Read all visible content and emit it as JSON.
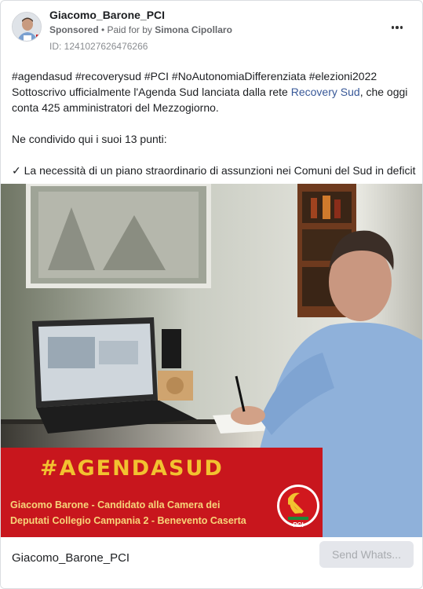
{
  "post": {
    "page_name": "Giacomo_Barone_PCI",
    "sponsored_label": "Sponsored",
    "separator": " • ",
    "paid_for_label": "Paid for by ",
    "payer": "Simona Cipollaro",
    "ad_id": "ID: 1241027626476266",
    "more_icon": "more-horizontal-icon"
  },
  "text": {
    "line1": "#agendasud #recoverysud #PCI #NoAutonomiaDifferenziata #elezioni2022",
    "line2_prefix": "Sottoscrivo ufficialmente l'Agenda Sud lanciata dalla rete ",
    "line2_link": "Recovery Sud",
    "line2_suffix": ", che oggi",
    "line3": "conta 425 amministratori del Mezzogiorno.",
    "line4": "Ne condivido qui i suoi 13 punti:",
    "line5": "✓ La necessità di un piano straordinario di assunzioni nei Comuni del Sud in deficit"
  },
  "media": {
    "banner_title": "#AGENDASUD",
    "banner_sub1": "Giacomo Barone - Candidato alla Camera dei",
    "banner_sub2": "Deputati Collegio Campania 2 - Benevento Caserta",
    "logo_text": "PCI",
    "colors": {
      "banner_red": "#c8161d",
      "title_yellow": "#f2c230"
    }
  },
  "footer": {
    "name": "Giacomo_Barone_PCI",
    "cta_label": "Send Whats..."
  }
}
